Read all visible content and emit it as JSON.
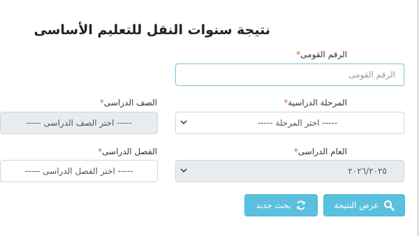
{
  "title": "نتيجة سنوات النقل للتعليم الأساسى",
  "fields": {
    "national_id": {
      "label": "الرقم القومى",
      "required": "*",
      "placeholder": "الرقم القومى"
    },
    "stage": {
      "label": "المرحلة الدراسية",
      "required": "*",
      "value": "----- اختر المرحلة -----"
    },
    "grade": {
      "label": "الصف الدراسى",
      "required": "*",
      "value": "----- اختر الصف الدراسى -----"
    },
    "year": {
      "label": "العام الدراسى",
      "required": "*",
      "value": "٢٠٢٦/٢٠٢٥"
    },
    "term": {
      "label": "الفصل الدراسى",
      "required": "*",
      "value": "----- اختر الفصل الدراسى -----"
    }
  },
  "buttons": {
    "show_result": {
      "label": "عرض النتيجة",
      "icon": "search-icon"
    },
    "new_search": {
      "label": "بحث جديد",
      "icon": "refresh-icon"
    }
  },
  "colors": {
    "button": "#5bc0de",
    "required": "#d9534f",
    "disabled_bg": "#e9ecef"
  }
}
